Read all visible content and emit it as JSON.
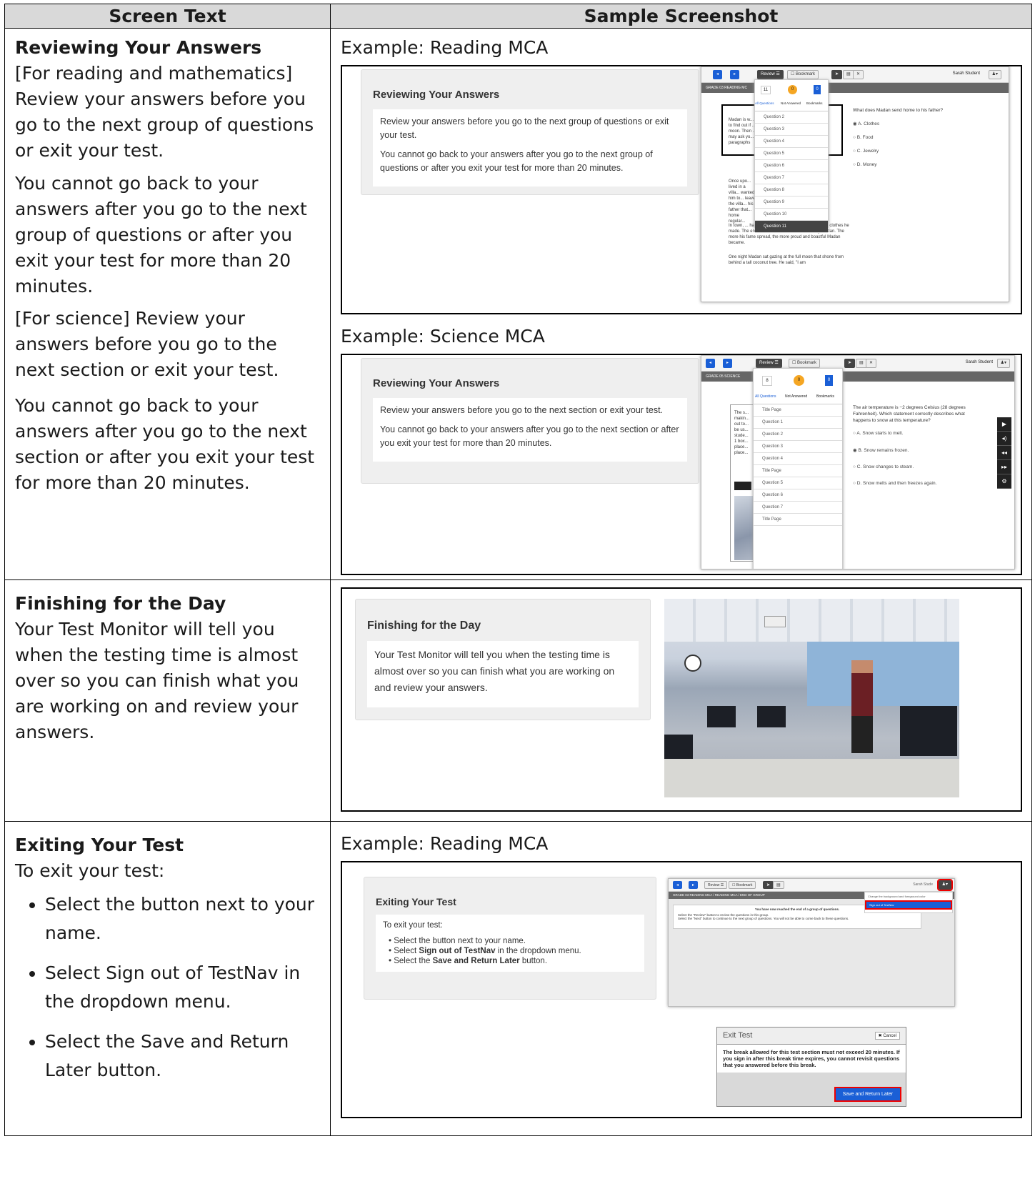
{
  "header": {
    "col1": "Screen Text",
    "col2": "Sample Screenshot"
  },
  "row1": {
    "heading": "Reviewing Your Answers",
    "p1": "[For reading and mathematics] Review your answers before you go to the next group of questions or exit your test.",
    "p2": "You cannot go back to your answers after you go to the next group of questions or after you exit your test for more than 20 minutes.",
    "p3": "[For science] Review your answers before you go to the next section or exit your test.",
    "p4": "You cannot go back to your answers after you go to the next section or after you exit your test for more than 20 minutes.",
    "example1": "Example: Reading MCA",
    "example2": "Example: Science MCA",
    "reading_panel": {
      "title": "Reviewing Your Answers",
      "p1": "Review your answers before you go to the next group of questions or exit your test.",
      "p2": "You cannot go back to your answers after you go to the next group of questions or after you exit your test for more than 20 minutes."
    },
    "science_panel": {
      "title": "Reviewing Your Answers",
      "p1": "Review your answers before you go to the next section or exit your test.",
      "p2": "You cannot go back to your answers after you go to the next section or after you exit your test for more than 20 minutes."
    },
    "reading_shot": {
      "review": "Review",
      "bookmark": "Bookmark",
      "student": "Sarah Student",
      "grade_bar": "GRADE 03 READING MC",
      "counts": {
        "all": "11",
        "not_answered": "0",
        "bookmarks": "0"
      },
      "tabs": {
        "all": "All Questions",
        "not_answered": "Not Answered",
        "bookmarks": "Bookmarks"
      },
      "items": [
        "Question 2",
        "Question 3",
        "Question 4",
        "Question 5",
        "Question 6",
        "Question 7",
        "Question 8",
        "Question 9",
        "Question 10",
        "Question 11"
      ],
      "question": "What does Madan send home to his father?",
      "answers": [
        "A. Clothes",
        "B. Food",
        "C. Jewelry",
        "D. Money"
      ],
      "passage_box": "Madan is w... to find out if ... moon. Then ... may ask yo... paragraphs",
      "passage1": "Once upo... lived in a villa... wanted him to... leave the villa... his father that... home regular...",
      "passage2": "In town, ... hard and soon became known for the fine clothes he made. The entire town wanted clothes sewed by Madan. The more his fame spread, the more proud and boastful Madan became.",
      "passage3": "One night Madan sat gazing at the full moon that shone from behind a tall coconut tree. He said, \"I am"
    },
    "science_shot": {
      "review": "Review",
      "bookmark": "Bookmark",
      "student": "Sarah Student",
      "grade_bar": "GRADE 05 SCIENCE",
      "counts": {
        "all": "8",
        "not_answered": "0",
        "bookmarks": "0"
      },
      "tabs": {
        "all": "All Questions",
        "not_answered": "Not Answered",
        "bookmarks": "Bookmarks"
      },
      "items": [
        "Title Page",
        "Question 1",
        "Question 2",
        "Question 3",
        "Question 4",
        "Title Page",
        "Question 5",
        "Question 6",
        "Question 7",
        "Title Page"
      ],
      "question": "The air temperature is −2 degrees Celsius (28 degrees Fahrenheit). Which statement correctly describes what happens to snow at this temperature?",
      "answers": [
        "A. Snow starts to melt.",
        "B. Snow remains frozen.",
        "C. Snow changes to steam.",
        "D. Snow melts and then freezes again."
      ],
      "passage": "The s... makin... out to... be us... stude... 1 box... place... place..."
    }
  },
  "row2": {
    "heading": "Finishing for the Day",
    "p1": "Your Test Monitor will tell you when the testing time is almost over so you can finish what you are working on and review your answers.",
    "panel": {
      "title": "Finishing for the Day",
      "text": "Your Test Monitor will tell you when the testing time is almost over so you can finish what you are working on and review your answers."
    }
  },
  "row3": {
    "heading": "Exiting Your Test",
    "intro": "To exit your test:",
    "bullets": [
      "Select the button next to your name.",
      "Select Sign out of TestNav in the dropdown menu.",
      "Select the Save and Return Later button."
    ],
    "example": "Example: Reading MCA",
    "panel": {
      "title": "Exiting Your Test",
      "intro": "To exit your test:",
      "b1": "Select the button next to your name.",
      "b2_pre": "Select ",
      "b2_bold": "Sign out of TestNav",
      "b2_post": " in the dropdown menu.",
      "b3_pre": "Select the ",
      "b3_bold": "Save and Return Later",
      "b3_post": " button."
    },
    "shot": {
      "review": "Review",
      "bookmark": "Bookmark",
      "student": "Sarah Stude",
      "grade_bar": "GRADE 03 READING MCA / READING MCA / END OF GROUP",
      "menu1": "Change the background and foreground color",
      "menu2": "Sign out of TestNav",
      "end_title": "You have now reached the end of a group of questions.",
      "end_l1": "Select the \"Review\" button to review the questions in this group.",
      "end_l2": "Select the \"Next\" button to continue to the next group of questions. You will not be able to come back to these questions."
    },
    "dialog": {
      "title": "Exit Test",
      "cancel": "✖ Cancel",
      "body": "The break allowed for this test section must not exceed 20 minutes. If you sign in after this break time expires, you cannot revisit questions that you answered before this break.",
      "save": "Save and Return Later"
    }
  },
  "colors": {
    "accent_blue": "#1a5fd6",
    "highlight_red": "#e00000",
    "orange": "#f5a623",
    "header_gray": "#d9d9d9"
  }
}
